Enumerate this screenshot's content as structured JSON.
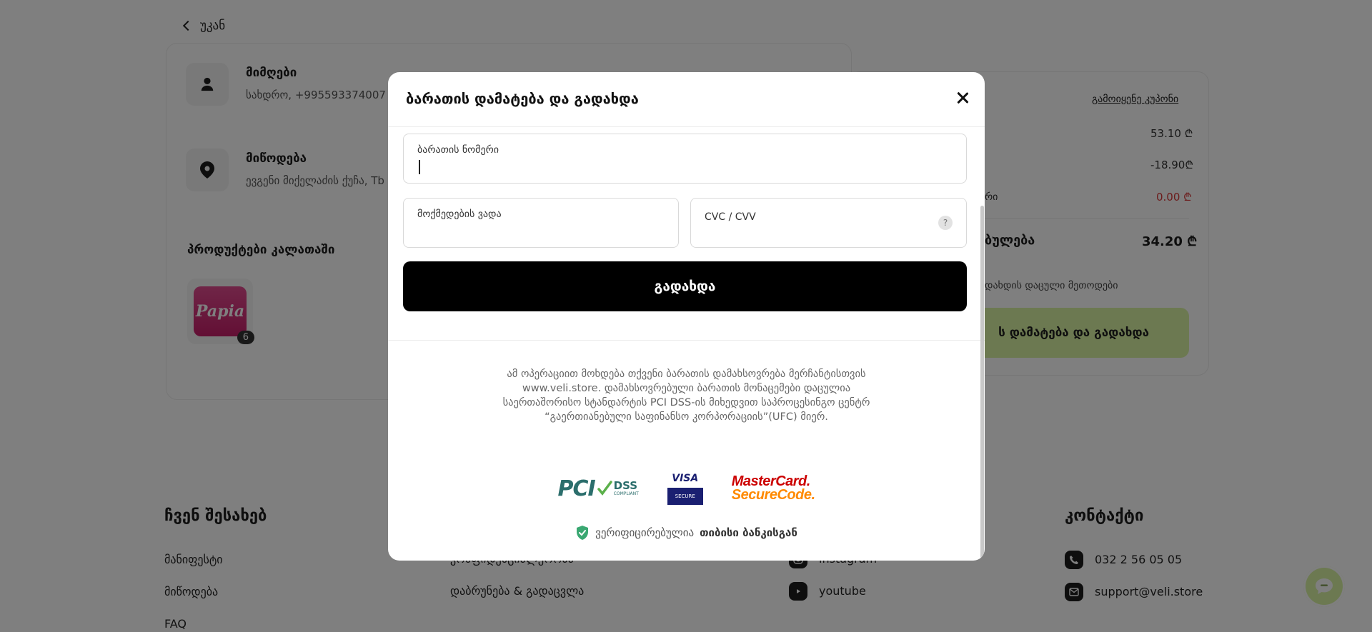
{
  "page": {
    "back_label": "უკან",
    "receiver": {
      "title": "მიმღები",
      "subtitle": "სახდრო, +995593374007"
    },
    "delivery": {
      "title": "მიწოდება",
      "subtitle": "ევგენი მიქელაძის ქუჩა, Tb"
    },
    "products_title": "პროდუქტები კალათაში",
    "product": {
      "brand": "Papia",
      "qty": "6"
    },
    "summary": {
      "coupon_link": "გამოიყენე კუპონი",
      "value1": "53.10 ₾",
      "value2": "-18.90₾",
      "label3": "რი",
      "value3": "0.00 ₾",
      "label4": "ბულება",
      "value4": "34.20 ₾",
      "label5": "დახდის დაცული მეთოდები",
      "button": "ს დამატება და გადახდა"
    },
    "footer": {
      "col1": {
        "title": "ჩვენ შესახებ",
        "links": [
          "მანიფესტი",
          "მიწოდება",
          "FAQ"
        ]
      },
      "col2": {
        "links": [
          "კონფიდენციალურობა",
          "დაბრუნება & გადაცვლა"
        ]
      },
      "col3": {
        "links": [
          "instagram",
          "youtube"
        ]
      },
      "col4": {
        "title": "კონტაქტი",
        "phone": "032 2 56 05 05",
        "email": "support@veli.store"
      }
    }
  },
  "modal": {
    "title": "ბარათის დამატება და გადახდა",
    "card_number_label": "ბარათის ნომერი",
    "card_number_value": "",
    "expiry_label": "მოქმედების ვადა",
    "cvc_label": "CVC / CVV",
    "help_symbol": "?",
    "pay_button": "გადახდა",
    "notice": "ამ ოპერაციით მოხდება თქვენი ბარათის დამახსოვრება მერჩანტისთვის www.veli.store. დამახსოვრებული ბარათის მონაცემები დაცულია საერთაშორისო სტანდარტის PCI DSS-ის მიხედვით საპროცესინგო ცენტრ “გაერთიანებული საფინანსო კორპორაციის”(UFC) მიერ.",
    "logos": {
      "pci": {
        "word": "PCI",
        "dss": "DSS",
        "compliant": "COMPLIANT"
      },
      "visa": {
        "word": "VISA",
        "secure": "SECURE"
      },
      "mastercard": {
        "line1": "MasterCard.",
        "line2": "SecureCode."
      }
    },
    "verified_prefix": "ვერიფიცირებულია",
    "verified_bank": "თიბისი ბანკისგან"
  },
  "colors": {
    "accent_green": "#d8f2a2",
    "pay_button": "#000000",
    "overlay": "rgba(0,0,0,0.5)",
    "danger": "#d93838"
  },
  "icons": [
    "chevron-left-icon",
    "user-icon",
    "location-pin-icon",
    "close-icon",
    "help-icon",
    "shield-check-icon",
    "phone-icon",
    "email-icon",
    "instagram-icon",
    "youtube-icon",
    "facebook-icon",
    "chat-icon"
  ]
}
